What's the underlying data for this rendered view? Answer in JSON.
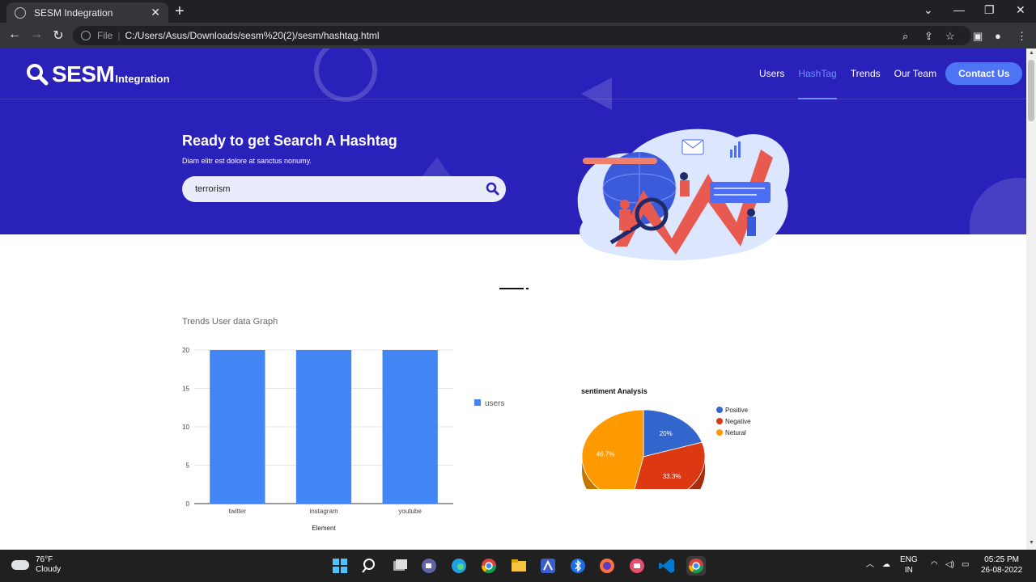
{
  "browser": {
    "tab_title": "SESM Indegration",
    "tab_close": "✕",
    "new_tab": "+",
    "url_prefix": "File",
    "url_separator": "|",
    "url": "C:/Users/Asus/Downloads/sesm%20(2)/sesm/hashtag.html",
    "win_min": "—",
    "win_max": "❐",
    "win_close": "✕",
    "dropdown": "⌄"
  },
  "site": {
    "logo_big": "SESM",
    "logo_small": "Integration",
    "nav": [
      {
        "label": "Users"
      },
      {
        "label": "HashTag"
      },
      {
        "label": "Trends"
      },
      {
        "label": "Our Team"
      }
    ],
    "contact": "Contact Us",
    "hero_title": "Ready to get Search A Hashtag",
    "hero_sub": "Diam elitr est dolore at sanctus nonumy.",
    "search_value": "terrorism",
    "graph_title": "Trends User data Graph"
  },
  "chart_data": [
    {
      "type": "bar",
      "categories": [
        "twitter",
        "instagram",
        "youtube"
      ],
      "series": [
        {
          "name": "users",
          "values": [
            20,
            20,
            20
          ]
        }
      ],
      "xlabel": "Element",
      "ylabel": "",
      "ylim": [
        0,
        20
      ],
      "yticks": [
        "0",
        "5",
        "10",
        "15",
        "20"
      ],
      "grid": true,
      "legend": "right",
      "color": "#4285f4"
    },
    {
      "type": "pie",
      "title": "sentiment Analysis",
      "labels": [
        "Positive",
        "Negative",
        "Netural"
      ],
      "values": [
        20,
        33.3,
        46.7
      ],
      "value_labels": [
        "20%",
        "33.3%",
        "46.7%"
      ],
      "colors": [
        "#3366cc",
        "#dc3912",
        "#ff9900"
      ],
      "legend": "right"
    }
  ],
  "taskbar": {
    "temp": "76°F",
    "condition": "Cloudy",
    "lang1": "ENG",
    "lang2": "IN",
    "time": "05:25 PM",
    "date": "26-08-2022"
  }
}
